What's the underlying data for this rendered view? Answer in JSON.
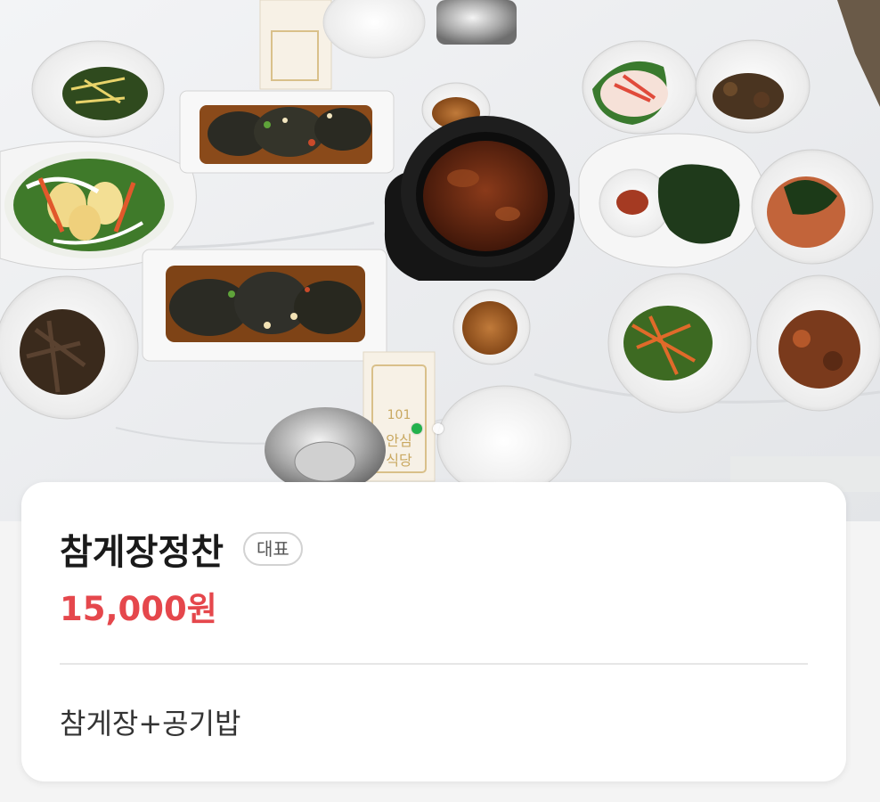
{
  "menu": {
    "name": "참게장정찬",
    "badge": "대표",
    "price": "15,000원",
    "description": "참게장+공기밥"
  },
  "gallery": {
    "photo_subject": "crab-meal-table-photo",
    "pager_count": 2,
    "active_index": 0
  },
  "photo_print": {
    "line1": "안심",
    "line2": "식당",
    "emblem": "101"
  },
  "colors": {
    "price": "#e5474c",
    "pager_active": "#22b14c",
    "badge_border": "#d2d2d2"
  }
}
